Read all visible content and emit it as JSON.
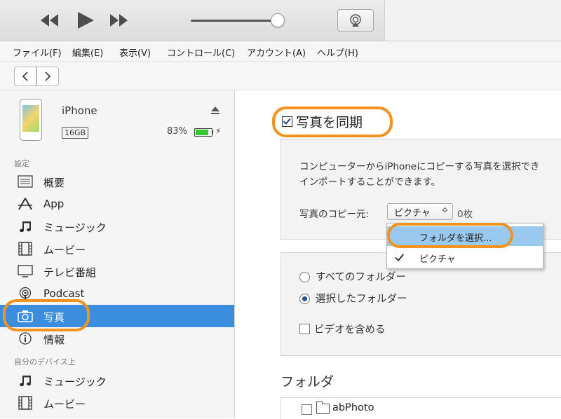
{
  "menu": [
    "ファイル(F)",
    "編集(E)",
    "表示(V)",
    "コントロール(C)",
    "アカウント(A)",
    "ヘルプ(H)"
  ],
  "device": {
    "name": "iPhone",
    "capacity": "16GB",
    "battery_pct": "83%",
    "battery_level": 0.83,
    "bolt": "⚡"
  },
  "sidebar": {
    "settings_label": "設定",
    "items": [
      {
        "label": "概要",
        "icon": "summary-icon"
      },
      {
        "label": "App",
        "icon": "app-icon"
      },
      {
        "label": "ミュージック",
        "icon": "music-note-icon"
      },
      {
        "label": "ムービー",
        "icon": "film-icon"
      },
      {
        "label": "テレビ番組",
        "icon": "tv-icon"
      },
      {
        "label": "Podcast",
        "icon": "podcast-icon"
      },
      {
        "label": "写真",
        "icon": "camera-icon",
        "selected": true
      },
      {
        "label": "情報",
        "icon": "info-icon"
      }
    ],
    "on_device_label": "自分のデバイス上",
    "device_items": [
      {
        "label": "ミュージック",
        "icon": "music-note-icon"
      },
      {
        "label": "ムービー",
        "icon": "film-icon"
      }
    ]
  },
  "main": {
    "sync_label": "写真を同期",
    "sync_checked": true,
    "description_line1": "コンピューターからiPhoneにコピーする写真を選択でき",
    "description_line2": "インポートすることができます。",
    "source_label": "写真のコピー元:",
    "source_value": "ピクチャ",
    "select_arrow": "≎",
    "photo_count": "0枚",
    "dropdown": {
      "choose_folder": "フォルダを選択...",
      "pictures": "ピクチャ"
    },
    "all_folders": "すべてのフォルダー",
    "selected_folders": "選択したフォルダー",
    "include_video": "ビデオを含める",
    "folder_heading": "フォルダ",
    "folders": [
      "abPhoto"
    ]
  },
  "colors": {
    "highlight": "#f3931f",
    "selection": "#3b8ede",
    "dropdown_highlight": "#99c9ef"
  }
}
